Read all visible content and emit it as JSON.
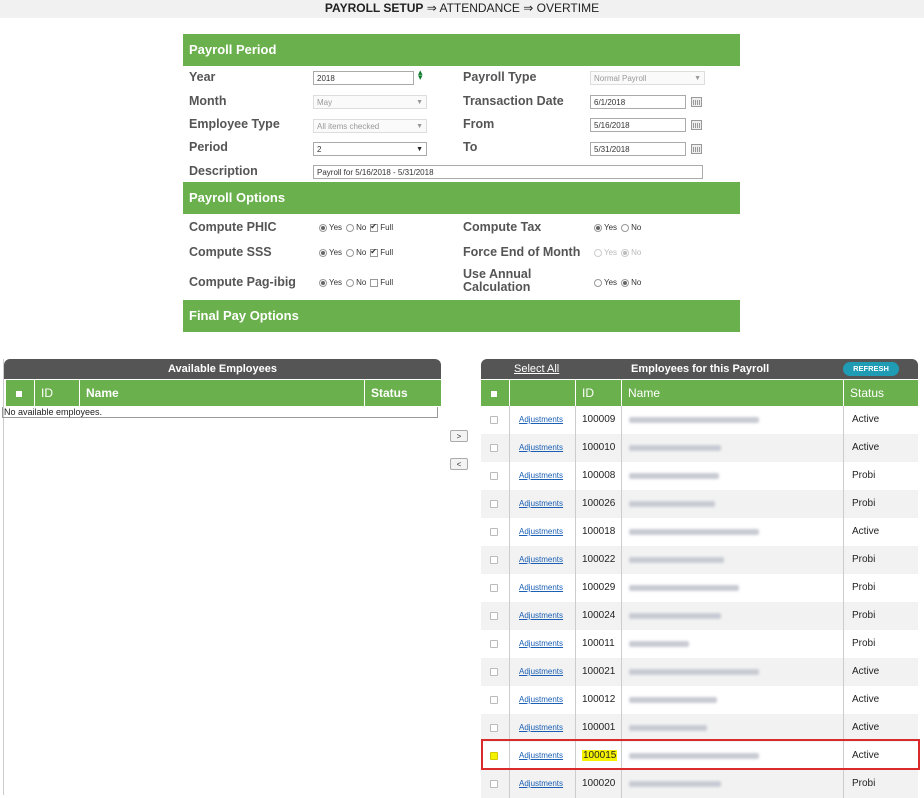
{
  "breadcrumb": {
    "bold": "PAYROLL SETUP",
    "rest": " ⇒ ATTENDANCE ⇒ OVERTIME"
  },
  "payroll_period": {
    "header": "Payroll Period",
    "year_label": "Year",
    "year_value": "2018",
    "month_label": "Month",
    "month_value": "May",
    "employee_type_label": "Employee Type",
    "employee_type_value": "All items checked",
    "period_label": "Period",
    "period_value": "2",
    "description_label": "Description",
    "description_value": "Payroll for 5/16/2018 - 5/31/2018",
    "payroll_type_label": "Payroll Type",
    "payroll_type_value": "Normal Payroll",
    "transaction_date_label": "Transaction Date",
    "transaction_date_value": "6/1/2018",
    "from_label": "From",
    "from_value": "5/16/2018",
    "to_label": "To",
    "to_value": "5/31/2018"
  },
  "payroll_options": {
    "header": "Payroll Options",
    "yes": "Yes",
    "no": "No",
    "full": "Full",
    "compute_phic": "Compute PHIC",
    "compute_sss": "Compute SSS",
    "compute_pagibig": "Compute Pag-ibig",
    "compute_tax": "Compute Tax",
    "force_end_month": "Force End of Month",
    "use_annual_calc": "Use Annual Calculation"
  },
  "final_pay": {
    "header": "Final Pay Options"
  },
  "available": {
    "title": "Available Employees",
    "col_id": "ID",
    "col_name": "Name",
    "col_status": "Status",
    "empty": "No available employees."
  },
  "move": {
    "right": ">",
    "left": "<"
  },
  "payroll_employees": {
    "select_all": "Select All",
    "title": "Employees for this Payroll",
    "refresh": "REFRESH",
    "col_id": "ID",
    "col_name": "Name",
    "col_status": "Status",
    "rows": [
      {
        "adj": "Adjustments",
        "id": "100009",
        "status": "Active"
      },
      {
        "adj": "Adjustments",
        "id": "100010",
        "status": "Active"
      },
      {
        "adj": "Adjustments",
        "id": "100008",
        "status": "Probi"
      },
      {
        "adj": "Adjustments",
        "id": "100026",
        "status": "Probi"
      },
      {
        "adj": "Adjustments",
        "id": "100018",
        "status": "Active"
      },
      {
        "adj": "Adjustments",
        "id": "100022",
        "status": "Probi"
      },
      {
        "adj": "Adjustments",
        "id": "100029",
        "status": "Probi"
      },
      {
        "adj": "Adjustments",
        "id": "100024",
        "status": "Probi"
      },
      {
        "adj": "Adjustments",
        "id": "100011",
        "status": "Probi"
      },
      {
        "adj": "Adjustments",
        "id": "100021",
        "status": "Active"
      },
      {
        "adj": "Adjustments",
        "id": "100012",
        "status": "Active"
      },
      {
        "adj": "Adjustments",
        "id": "100001",
        "status": "Active"
      },
      {
        "adj": "Adjustments",
        "id": "100015",
        "status": "Active"
      },
      {
        "adj": "Adjustments",
        "id": "100020",
        "status": "Probi"
      }
    ]
  }
}
